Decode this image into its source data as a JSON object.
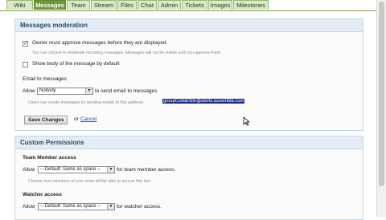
{
  "tabs": [
    {
      "label": "Wiki"
    },
    {
      "label": "Messages"
    },
    {
      "label": "Team"
    },
    {
      "label": "Stream"
    },
    {
      "label": "Files"
    },
    {
      "label": "Chat"
    },
    {
      "label": "Admin"
    },
    {
      "label": "Tickets"
    },
    {
      "label": "Images"
    },
    {
      "label": "Milestones"
    }
  ],
  "moderation": {
    "title": "Messages moderation",
    "owner_approve_label": "Owner must approve messages before they are displayed",
    "owner_approve_checked": true,
    "owner_approve_hint": "You can choose to moderate incoming messages. Messages will not be visible until you approve them.",
    "show_body_label": "Show body of the message by default",
    "show_body_checked": false,
    "email_heading": "Email to messages",
    "allow_label": "Allow",
    "allow_value": "Nobody",
    "send_email_suffix": "to send email to messages",
    "email_hint": "Users can create messages by sending emails to this address:",
    "email_address": "groupCollabSite@alerts.assembla.com",
    "save_label": "Save Changes",
    "or_label": "or",
    "cancel_label": "Cancel"
  },
  "permissions": {
    "title": "Custom Permissions",
    "team_heading": "Team Member access",
    "allow_label": "Allow",
    "team_value": "-- Default: Same as space --",
    "team_suffix": "for team member access.",
    "team_hint": "Choose how members of your team will be able to access this tool",
    "watcher_heading": "Watcher access",
    "watcher_value": "-- Default: Same as space --",
    "watcher_suffix": "for watcher access."
  },
  "colors": {
    "tab_active": "#6e9a3c",
    "tab_inactive": "#d9e8c6",
    "panel_header": "#e4ecf5",
    "email_highlight": "#1c2a80",
    "link": "#2a4fb5"
  }
}
